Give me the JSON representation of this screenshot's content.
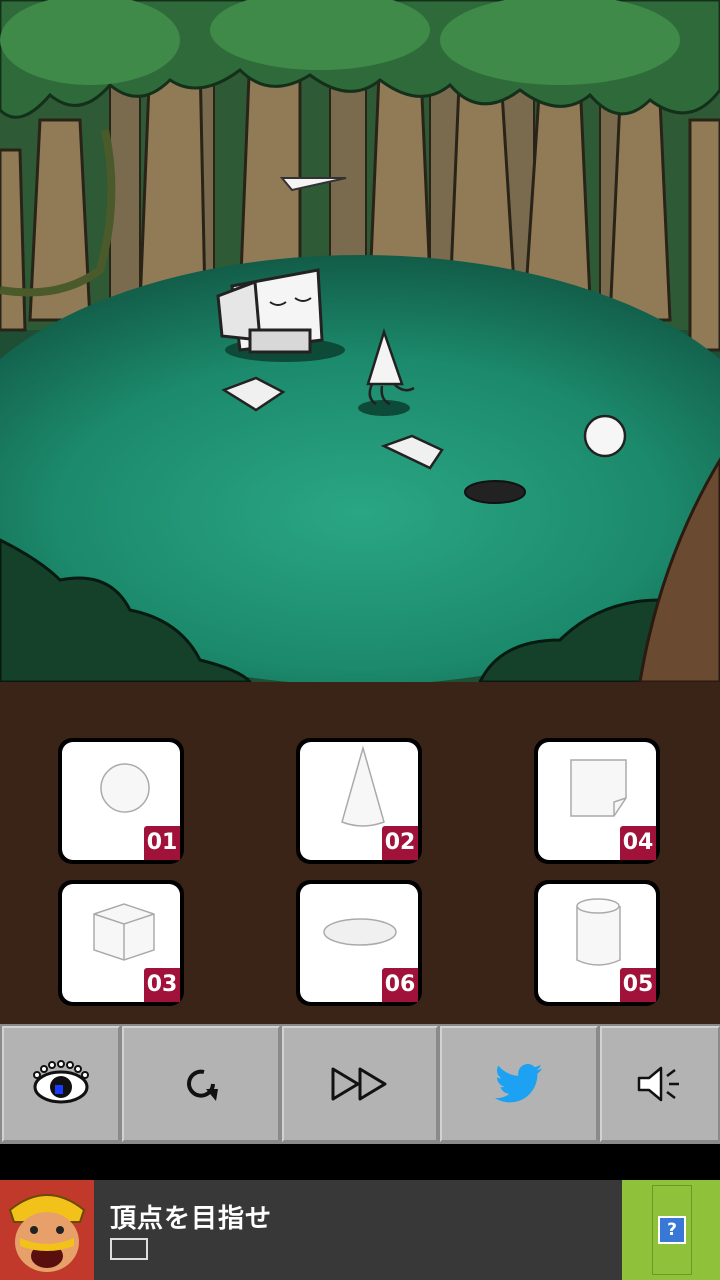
{
  "inventory": {
    "slots": [
      {
        "number": "01",
        "item": "sphere"
      },
      {
        "number": "02",
        "item": "cone"
      },
      {
        "number": "04",
        "item": "paper-sheet"
      },
      {
        "number": "03",
        "item": "cube"
      },
      {
        "number": "06",
        "item": "disc"
      },
      {
        "number": "05",
        "item": "cylinder"
      }
    ]
  },
  "toolbar": {
    "buttons": [
      {
        "name": "hint-eye",
        "icon": "eye-icon"
      },
      {
        "name": "restart",
        "icon": "restart-icon"
      },
      {
        "name": "skip",
        "icon": "fast-forward-icon"
      },
      {
        "name": "twitter",
        "icon": "twitter-bird-icon"
      },
      {
        "name": "sound",
        "icon": "speaker-icon"
      }
    ]
  },
  "ad": {
    "title": "頂点を目指せ",
    "help_label": "?"
  },
  "colors": {
    "ground": "#1c8a6c",
    "inventory_bg": "#3a2418",
    "slot_badge": "#a0123a",
    "toolbar": "#b3b3b3",
    "twitter_blue": "#1da1f2",
    "ad_bg": "#383838",
    "ad_green": "#8fc23a"
  }
}
